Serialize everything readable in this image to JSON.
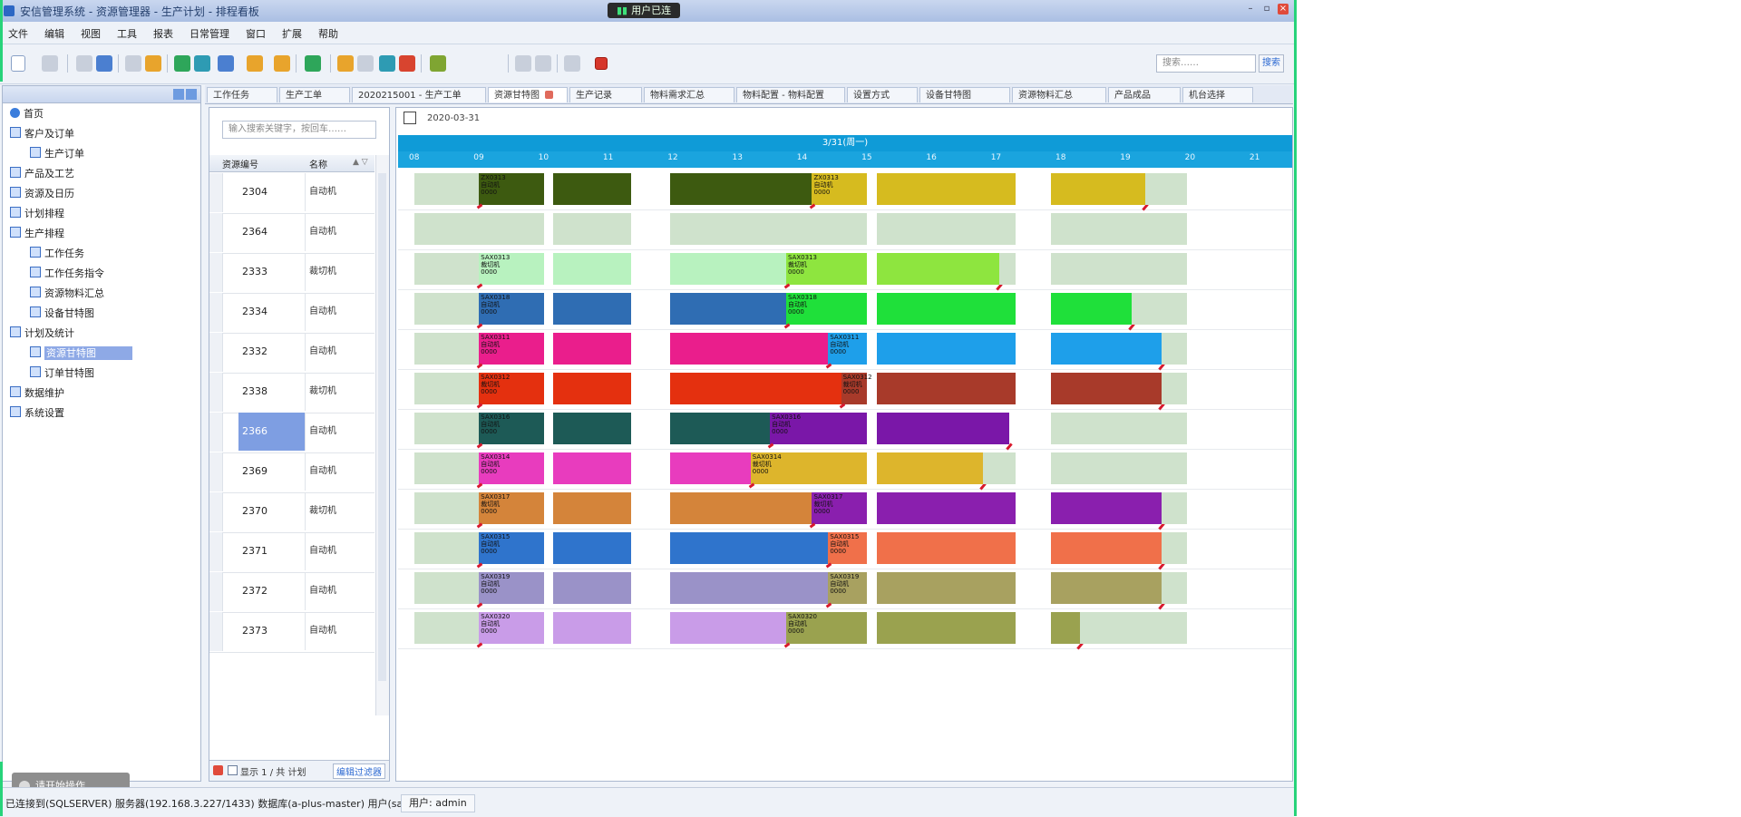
{
  "window": {
    "title": "安信管理系统 - 资源管理器 - 生产计划 - 排程看板",
    "status_pill": "用户已连"
  },
  "menu": [
    "文件",
    "编辑",
    "视图",
    "工具",
    "报表",
    "日常管理",
    "窗口",
    "扩展",
    "帮助"
  ],
  "search": {
    "placeholder": "搜索……",
    "button": "搜索"
  },
  "nav": {
    "items": [
      {
        "label": "首页",
        "icon": "globe",
        "level": 0
      },
      {
        "label": "客户及订单",
        "icon": "folder",
        "level": 0
      },
      {
        "label": "生产订单",
        "icon": "doc",
        "level": 1
      },
      {
        "label": "产品及工艺",
        "icon": "folder",
        "level": 0
      },
      {
        "label": "资源及日历",
        "icon": "folder",
        "level": 0
      },
      {
        "label": "计划排程",
        "icon": "folder",
        "level": 0
      },
      {
        "label": "生产排程",
        "icon": "folder",
        "level": 0
      },
      {
        "label": "工作任务",
        "icon": "doc",
        "level": 1
      },
      {
        "label": "工作任务指令",
        "icon": "doc",
        "level": 1
      },
      {
        "label": "资源物料汇总",
        "icon": "doc",
        "level": 1
      },
      {
        "label": "设备甘特图",
        "icon": "doc",
        "level": 1
      },
      {
        "label": "计划及统计",
        "icon": "folder",
        "level": 0
      },
      {
        "label": "资源甘特图",
        "icon": "doc",
        "level": 1,
        "selected": true
      },
      {
        "label": "订单甘特图",
        "icon": "doc",
        "level": 1
      },
      {
        "label": "数据维护",
        "icon": "folder",
        "level": 0
      },
      {
        "label": "系统设置",
        "icon": "folder",
        "level": 0
      }
    ],
    "float_badge": "请开始操作……"
  },
  "tabs": [
    {
      "label": "工作任务"
    },
    {
      "label": "生产工单"
    },
    {
      "label": "2020215001 - 生产工单"
    },
    {
      "label": "资源甘特图",
      "active": true
    },
    {
      "label": "生产记录"
    },
    {
      "label": "物料需求汇总"
    },
    {
      "label": "物料配置 - 物料配置"
    },
    {
      "label": "设置方式"
    },
    {
      "label": "设备甘特图"
    },
    {
      "label": "资源物料汇总"
    },
    {
      "label": "产品成品"
    },
    {
      "label": "机台选择"
    }
  ],
  "resources": {
    "search_placeholder": "输入搜索关键字，按回车……",
    "col_code": "资源编号",
    "col_name": "名称",
    "rows": [
      {
        "code": "2304",
        "name": "自动机"
      },
      {
        "code": "2364",
        "name": "自动机"
      },
      {
        "code": "2333",
        "name": "裁切机"
      },
      {
        "code": "2334",
        "name": "自动机"
      },
      {
        "code": "2332",
        "name": "自动机"
      },
      {
        "code": "2338",
        "name": "裁切机"
      },
      {
        "code": "2366",
        "name": "自动机",
        "selected": true
      },
      {
        "code": "2369",
        "name": "自动机"
      },
      {
        "code": "2370",
        "name": "裁切机"
      },
      {
        "code": "2371",
        "name": "自动机"
      },
      {
        "code": "2372",
        "name": "自动机"
      },
      {
        "code": "2373",
        "name": "自动机"
      }
    ],
    "footer_text": "显示 1 / 共 计划",
    "footer_button": "编辑过滤器"
  },
  "gantt": {
    "date": "2020-03-31",
    "day_label": "3/31(周一)",
    "hours": [
      "08",
      "09",
      "10",
      "11",
      "12",
      "13",
      "14",
      "15",
      "16",
      "17",
      "18",
      "19",
      "20",
      "21"
    ],
    "rows": [
      {
        "bars": [
          {
            "s": 7.0,
            "e": 8.0,
            "c": "#cfe2cc"
          },
          {
            "s": 8.0,
            "e": 9.0,
            "c": "#3d5a10",
            "lbl": "ZX0313\n自动机\n0000"
          },
          {
            "s": 9.15,
            "e": 10.35,
            "c": "#3d5a10"
          },
          {
            "s": 10.95,
            "e": 13.15,
            "c": "#3d5a10"
          },
          {
            "s": 13.15,
            "e": 14.0,
            "c": "#d6bb1f",
            "lbl": "ZX0313\n自动机\n0000"
          },
          {
            "s": 14.15,
            "e": 16.3,
            "c": "#d6bb1f"
          },
          {
            "s": 16.85,
            "e": 18.3,
            "c": "#d6bb1f",
            "end": true
          },
          {
            "s": 18.3,
            "e": 18.95,
            "c": "#cfe2cc"
          }
        ]
      },
      {
        "bars": [
          {
            "s": 7.0,
            "e": 9.0,
            "c": "#cfe2cc"
          },
          {
            "s": 9.15,
            "e": 10.35,
            "c": "#cfe2cc"
          },
          {
            "s": 10.95,
            "e": 14.0,
            "c": "#cfe2cc"
          },
          {
            "s": 14.15,
            "e": 16.3,
            "c": "#cfe2cc"
          },
          {
            "s": 16.85,
            "e": 18.95,
            "c": "#cfe2cc"
          }
        ]
      },
      {
        "bars": [
          {
            "s": 7.0,
            "e": 8.0,
            "c": "#cfe2cc"
          },
          {
            "s": 8.0,
            "e": 9.0,
            "c": "#b8f2bf",
            "lbl": "SAX0313\n裁切机\n0000"
          },
          {
            "s": 9.15,
            "e": 10.35,
            "c": "#b8f2bf"
          },
          {
            "s": 10.95,
            "e": 12.75,
            "c": "#b8f2bf"
          },
          {
            "s": 12.75,
            "e": 14.0,
            "c": "#8ee53f",
            "lbl": "SAX0313\n裁切机\n0000"
          },
          {
            "s": 14.15,
            "e": 16.05,
            "c": "#8ee53f",
            "end": true
          },
          {
            "s": 16.05,
            "e": 16.3,
            "c": "#cfe2cc"
          },
          {
            "s": 16.85,
            "e": 18.95,
            "c": "#cfe2cc"
          }
        ]
      },
      {
        "bars": [
          {
            "s": 7.0,
            "e": 8.0,
            "c": "#cfe2cc"
          },
          {
            "s": 8.0,
            "e": 9.0,
            "c": "#2f6db3",
            "lbl": "SAX0318\n自动机\n0000"
          },
          {
            "s": 9.15,
            "e": 10.35,
            "c": "#2f6db3"
          },
          {
            "s": 10.95,
            "e": 12.75,
            "c": "#2f6db3"
          },
          {
            "s": 12.75,
            "e": 14.0,
            "c": "#1fe03a",
            "lbl": "SAX0318\n自动机\n0000"
          },
          {
            "s": 14.15,
            "e": 16.3,
            "c": "#1fe03a"
          },
          {
            "s": 16.85,
            "e": 18.1,
            "c": "#1fe03a",
            "end": true
          },
          {
            "s": 18.1,
            "e": 18.95,
            "c": "#cfe2cc"
          }
        ]
      },
      {
        "bars": [
          {
            "s": 7.0,
            "e": 8.0,
            "c": "#cfe2cc"
          },
          {
            "s": 8.0,
            "e": 9.0,
            "c": "#ea1e8c",
            "lbl": "SAX0311\n自动机\n0000"
          },
          {
            "s": 9.15,
            "e": 10.35,
            "c": "#ea1e8c"
          },
          {
            "s": 10.95,
            "e": 13.4,
            "c": "#ea1e8c"
          },
          {
            "s": 13.4,
            "e": 14.0,
            "c": "#1e9fea",
            "lbl": "SAX0311\n自动机\n0000"
          },
          {
            "s": 14.15,
            "e": 16.3,
            "c": "#1e9fea"
          },
          {
            "s": 16.85,
            "e": 18.55,
            "c": "#1e9fea",
            "end": true
          },
          {
            "s": 18.55,
            "e": 18.95,
            "c": "#cfe2cc"
          }
        ]
      },
      {
        "bars": [
          {
            "s": 7.0,
            "e": 8.0,
            "c": "#cfe2cc"
          },
          {
            "s": 8.0,
            "e": 9.0,
            "c": "#e4300f",
            "lbl": "SAX0312\n裁切机\n0000"
          },
          {
            "s": 9.15,
            "e": 10.35,
            "c": "#e4300f"
          },
          {
            "s": 10.95,
            "e": 13.6,
            "c": "#e4300f"
          },
          {
            "s": 13.6,
            "e": 14.0,
            "c": "#a83a2a",
            "lbl": "SAX0312\n裁切机\n0000"
          },
          {
            "s": 14.15,
            "e": 16.3,
            "c": "#a83a2a"
          },
          {
            "s": 16.85,
            "e": 18.55,
            "c": "#a83a2a",
            "end": true
          },
          {
            "s": 18.55,
            "e": 18.95,
            "c": "#cfe2cc"
          }
        ]
      },
      {
        "bars": [
          {
            "s": 7.0,
            "e": 8.0,
            "c": "#cfe2cc"
          },
          {
            "s": 8.0,
            "e": 9.0,
            "c": "#1d5a56",
            "lbl": "SAX0316\n自动机\n0000"
          },
          {
            "s": 9.15,
            "e": 10.35,
            "c": "#1d5a56"
          },
          {
            "s": 10.95,
            "e": 12.5,
            "c": "#1d5a56"
          },
          {
            "s": 12.5,
            "e": 14.0,
            "c": "#7a17a8",
            "lbl": "SAX0316\n自动机\n0000"
          },
          {
            "s": 14.15,
            "e": 16.2,
            "c": "#7a17a8",
            "end": true
          },
          {
            "s": 16.85,
            "e": 18.95,
            "c": "#cfe2cc"
          }
        ]
      },
      {
        "bars": [
          {
            "s": 7.0,
            "e": 8.0,
            "c": "#cfe2cc"
          },
          {
            "s": 8.0,
            "e": 9.0,
            "c": "#e83cbe",
            "lbl": "SAX0314\n自动机\n0000"
          },
          {
            "s": 9.15,
            "e": 10.35,
            "c": "#e83cbe"
          },
          {
            "s": 10.95,
            "e": 12.2,
            "c": "#e83cbe"
          },
          {
            "s": 12.2,
            "e": 14.0,
            "c": "#ddb52c",
            "lbl": "SAX0314\n裁切机\n0000"
          },
          {
            "s": 14.15,
            "e": 15.8,
            "c": "#ddb52c",
            "end": true
          },
          {
            "s": 15.8,
            "e": 16.3,
            "c": "#cfe2cc"
          },
          {
            "s": 16.85,
            "e": 18.95,
            "c": "#cfe2cc"
          }
        ]
      },
      {
        "bars": [
          {
            "s": 7.0,
            "e": 8.0,
            "c": "#cfe2cc"
          },
          {
            "s": 8.0,
            "e": 9.0,
            "c": "#d4843a",
            "lbl": "SAX0317\n裁切机\n0000"
          },
          {
            "s": 9.15,
            "e": 10.35,
            "c": "#d4843a"
          },
          {
            "s": 10.95,
            "e": 13.15,
            "c": "#d4843a"
          },
          {
            "s": 13.15,
            "e": 14.0,
            "c": "#8a1fae",
            "lbl": "SAX0317\n裁切机\n0000"
          },
          {
            "s": 14.15,
            "e": 16.3,
            "c": "#8a1fae"
          },
          {
            "s": 16.85,
            "e": 18.55,
            "c": "#8a1fae",
            "end": true
          },
          {
            "s": 18.55,
            "e": 18.95,
            "c": "#cfe2cc"
          }
        ]
      },
      {
        "bars": [
          {
            "s": 7.0,
            "e": 8.0,
            "c": "#cfe2cc"
          },
          {
            "s": 8.0,
            "e": 9.0,
            "c": "#2f74cc",
            "lbl": "SAX0315\n自动机\n0000"
          },
          {
            "s": 9.15,
            "e": 10.35,
            "c": "#2f74cc"
          },
          {
            "s": 10.95,
            "e": 13.4,
            "c": "#2f74cc"
          },
          {
            "s": 13.4,
            "e": 14.0,
            "c": "#f0704a",
            "lbl": "SAX0315\n自动机\n0000"
          },
          {
            "s": 14.15,
            "e": 16.3,
            "c": "#f0704a"
          },
          {
            "s": 16.85,
            "e": 18.55,
            "c": "#f0704a",
            "end": true
          },
          {
            "s": 18.55,
            "e": 18.95,
            "c": "#cfe2cc"
          }
        ]
      },
      {
        "bars": [
          {
            "s": 7.0,
            "e": 8.0,
            "c": "#cfe2cc"
          },
          {
            "s": 8.0,
            "e": 9.0,
            "c": "#9a92c8",
            "lbl": "SAX0319\n自动机\n0000"
          },
          {
            "s": 9.15,
            "e": 10.35,
            "c": "#9a92c8"
          },
          {
            "s": 10.95,
            "e": 13.4,
            "c": "#9a92c8"
          },
          {
            "s": 13.4,
            "e": 14.0,
            "c": "#a8a160",
            "lbl": "SAX0319\n自动机\n0000"
          },
          {
            "s": 14.15,
            "e": 16.3,
            "c": "#a8a160"
          },
          {
            "s": 16.85,
            "e": 18.55,
            "c": "#a8a160",
            "end": true
          },
          {
            "s": 18.55,
            "e": 18.95,
            "c": "#cfe2cc"
          }
        ]
      },
      {
        "bars": [
          {
            "s": 7.0,
            "e": 8.0,
            "c": "#cfe2cc"
          },
          {
            "s": 8.0,
            "e": 9.0,
            "c": "#c99ce8",
            "lbl": "SAX0320\n自动机\n0000"
          },
          {
            "s": 9.15,
            "e": 10.35,
            "c": "#c99ce8"
          },
          {
            "s": 10.95,
            "e": 12.75,
            "c": "#c99ce8"
          },
          {
            "s": 12.75,
            "e": 14.0,
            "c": "#9aa24f",
            "lbl": "SAX0320\n自动机\n0000"
          },
          {
            "s": 14.15,
            "e": 16.3,
            "c": "#9aa24f"
          },
          {
            "s": 16.85,
            "e": 17.3,
            "c": "#9aa24f",
            "end": true
          },
          {
            "s": 17.3,
            "e": 18.95,
            "c": "#cfe2cc"
          }
        ]
      }
    ]
  },
  "status": {
    "text": "已连接到(SQLSERVER) 服务器(192.168.3.227/1433) 数据库(a-plus-master) 用户(sa)",
    "user": "用户: admin"
  }
}
